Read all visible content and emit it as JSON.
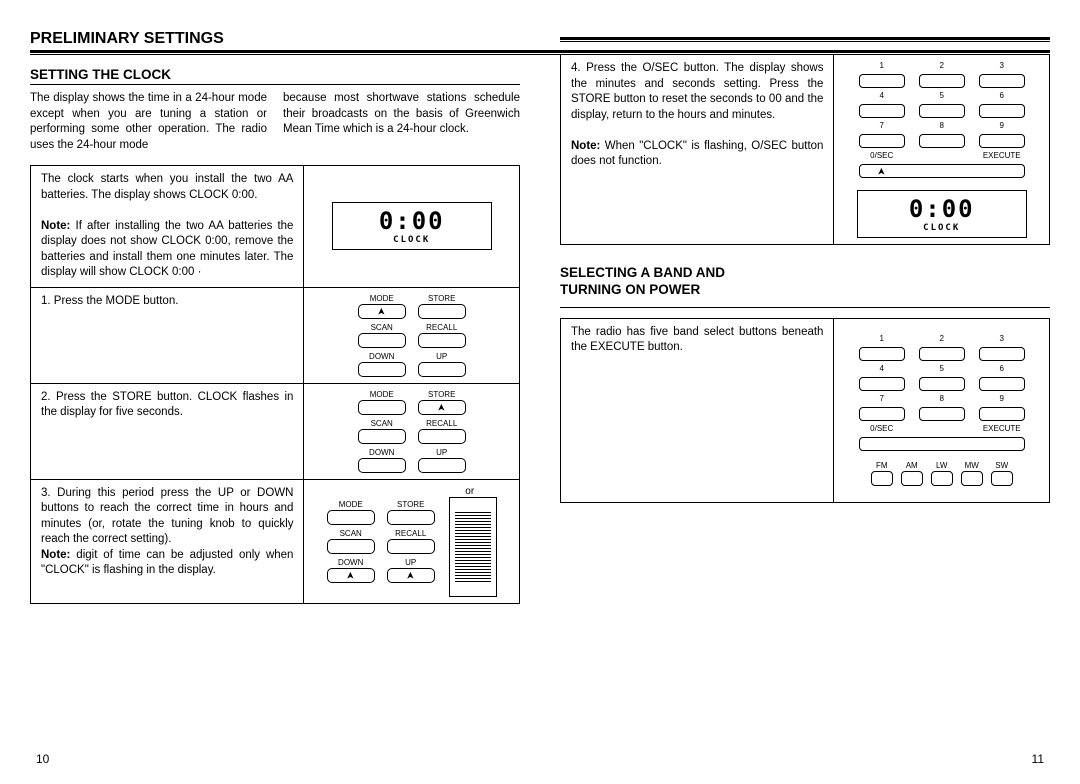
{
  "page": {
    "title": "PRELIMINARY SETTINGS",
    "pageLeft": "10",
    "pageRight": "11"
  },
  "left": {
    "subtitle": "SETTING THE CLOCK",
    "intro1": "The display shows the time in a 24-hour mode except when you are tuning a station or performing some other operation. The radio uses the 24-hour mode",
    "intro2": "because most shortwave stations schedule their broadcasts on the basis of Greenwich Mean Time which is a 24-hour clock.",
    "row0": {
      "p1": "The clock starts when you install the two AA batteries. The display shows CLOCK 0:00.",
      "noteLabel": "Note:",
      "p2": " If after installing the two AA batteries the display does not show CLOCK 0:00, remove the batteries and install them one minutes later. The display will show CLOCK 0:00 ·",
      "lcdDigits": "0:00",
      "lcdLabel": "CLOCK"
    },
    "row1": {
      "text": "1. Press the MODE button.",
      "labels": {
        "mode": "MODE",
        "store": "STORE",
        "scan": "SCAN",
        "recall": "RECALL",
        "down": "DOWN",
        "up": "UP"
      }
    },
    "row2": {
      "text": "2. Press the STORE button. CLOCK flashes in the display for five seconds.",
      "labels": {
        "mode": "MODE",
        "store": "STORE",
        "scan": "SCAN",
        "recall": "RECALL",
        "down": "DOWN",
        "up": "UP"
      }
    },
    "row3": {
      "p1": "3. During this period press the UP or DOWN buttons to reach the correct time in hours and minutes (or, rotate the tuning knob to quickly reach the correct setting).",
      "noteLabel": "Note:",
      "p2": " digit of time can be adjusted only when \"CLOCK\" is flashing in the display.",
      "labels": {
        "mode": "MODE",
        "store": "STORE",
        "scan": "SCAN",
        "recall": "RECALL",
        "down": "DOWN",
        "up": "UP",
        "or": "or"
      }
    }
  },
  "right": {
    "row4": {
      "p1": "4. Press the O/SEC button. The display shows the minutes and seconds setting. Press the STORE button to reset the seconds to 00 and the display, return to the hours and minutes.",
      "noteLabel": "Note:",
      "p2": " When \"CLOCK\" is flashing, O/SEC button does not function.",
      "keypad": {
        "n1": "1",
        "n2": "2",
        "n3": "3",
        "n4": "4",
        "n5": "5",
        "n6": "6",
        "n7": "7",
        "n8": "8",
        "n9": "9",
        "osec": "0/SEC",
        "exec": "EXECUTE"
      },
      "lcdDigits": "0:00",
      "lcdLabel": "CLOCK"
    },
    "subtitle2a": "SELECTING A BAND AND",
    "subtitle2b": "TURNING ON POWER",
    "row5": {
      "text": "The radio has five band select buttons beneath the EXECUTE button.",
      "keypad": {
        "n1": "1",
        "n2": "2",
        "n3": "3",
        "n4": "4",
        "n5": "5",
        "n6": "6",
        "n7": "7",
        "n8": "8",
        "n9": "9",
        "osec": "0/SEC",
        "exec": "EXECUTE"
      },
      "bands": {
        "fm": "FM",
        "am": "AM",
        "lw": "LW",
        "mw": "MW",
        "sw": "SW"
      }
    }
  }
}
